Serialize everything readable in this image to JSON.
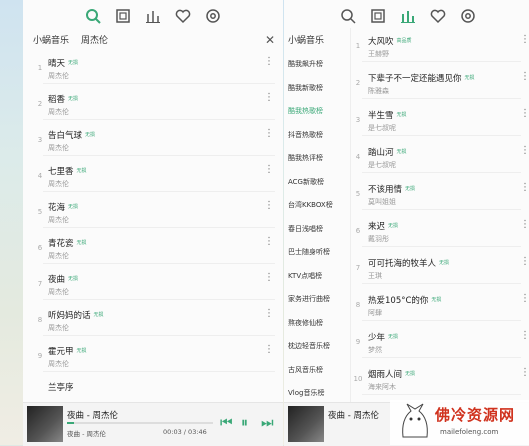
{
  "colors": {
    "accent": "#3aa877"
  },
  "left_panel": {
    "toolbar_icons": [
      "search-icon",
      "window-icon",
      "chart-icon",
      "heart-icon",
      "settings-icon"
    ],
    "tabs": [
      "小蜗音乐",
      "周杰伦"
    ],
    "close_label": "✕",
    "songs": [
      {
        "num": "1",
        "title": "晴天",
        "badge": "无损",
        "artist": "周杰伦"
      },
      {
        "num": "2",
        "title": "稻香",
        "badge": "无损",
        "artist": "周杰伦"
      },
      {
        "num": "3",
        "title": "告白气球",
        "badge": "无损",
        "artist": "周杰伦"
      },
      {
        "num": "4",
        "title": "七里香",
        "badge": "无损",
        "artist": "周杰伦"
      },
      {
        "num": "5",
        "title": "花海",
        "badge": "无损",
        "artist": "周杰伦"
      },
      {
        "num": "6",
        "title": "青花瓷",
        "badge": "无损",
        "artist": "周杰伦"
      },
      {
        "num": "7",
        "title": "夜曲",
        "badge": "无损",
        "artist": "周杰伦"
      },
      {
        "num": "8",
        "title": "听妈妈的话",
        "badge": "无损",
        "artist": "周杰伦"
      },
      {
        "num": "9",
        "title": "霍元甲",
        "badge": "无损",
        "artist": "周杰伦"
      },
      {
        "num": "",
        "title": "兰亭序",
        "badge": "",
        "artist": ""
      }
    ],
    "player": {
      "title": "夜曲 - 周杰伦",
      "artist": "夜曲 - 周杰伦",
      "time": "00:03 / 03:46",
      "progress": 0.05
    }
  },
  "right_panel": {
    "tab": "小蜗音乐",
    "categories": [
      "酷我飙升榜",
      "酷我新歌榜",
      "酷我热歌榜",
      "抖音热歌榜",
      "酷我热评榜",
      "ACG新歌榜",
      "台湾KKBOX榜",
      "春日浅唱榜",
      "巴士随身听榜",
      "KTV点唱榜",
      "家务进行曲榜",
      "熬夜修仙榜",
      "枕边轻音乐榜",
      "古风音乐榜",
      "Vlog音乐榜"
    ],
    "active_category": 2,
    "songs": [
      {
        "num": "1",
        "title": "大风吹",
        "badge": "高品质",
        "artist": "王赫野"
      },
      {
        "num": "2",
        "title": "下辈子不一定还能遇见你",
        "badge": "无损",
        "artist": "陈雅森"
      },
      {
        "num": "3",
        "title": "半生雪",
        "badge": "无损",
        "artist": "是七叔呢"
      },
      {
        "num": "4",
        "title": "踏山河",
        "badge": "无损",
        "artist": "是七叔呢"
      },
      {
        "num": "5",
        "title": "不该用情",
        "badge": "无损",
        "artist": "莫叫姐姐"
      },
      {
        "num": "6",
        "title": "来迟",
        "badge": "无损",
        "artist": "戴羽彤"
      },
      {
        "num": "7",
        "title": "可可托海的牧羊人",
        "badge": "无损",
        "artist": "王琪"
      },
      {
        "num": "8",
        "title": "热爱105°C的你",
        "badge": "无损",
        "artist": "阿肆"
      },
      {
        "num": "9",
        "title": "少年",
        "badge": "无损",
        "artist": "梦然"
      },
      {
        "num": "10",
        "title": "烟雨人间",
        "badge": "无损",
        "artist": "海来阿木"
      }
    ],
    "player": {
      "title": "夜曲 - 周杰伦"
    }
  },
  "watermark": {
    "cn": "佛冷资源网",
    "en": "mailefoleng.com"
  }
}
